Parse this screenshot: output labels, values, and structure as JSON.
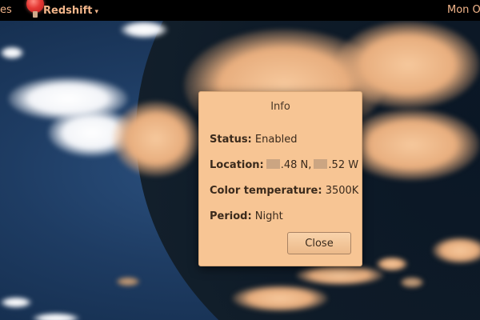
{
  "topbar": {
    "activities_label": "es",
    "app_name": "Redshift",
    "app_menu_caret": "▾",
    "clock": "Mon O"
  },
  "dialog": {
    "title": "Info",
    "status_label": "Status:",
    "status_value": "Enabled",
    "location_label": "Location:",
    "location_lat": ".48 N,",
    "location_lon": ".52 W",
    "temperature_label": "Color temperature:",
    "temperature_value": "3500K",
    "period_label": "Period:",
    "period_value": "Night",
    "close_label": "Close"
  },
  "icons": {
    "app_icon": "redshift-bulb-icon"
  },
  "colors": {
    "topbar_bg": "#000000",
    "topbar_text": "#f2b58a",
    "dialog_bg": "#f7c594",
    "dialog_text": "#3a2a1c"
  }
}
